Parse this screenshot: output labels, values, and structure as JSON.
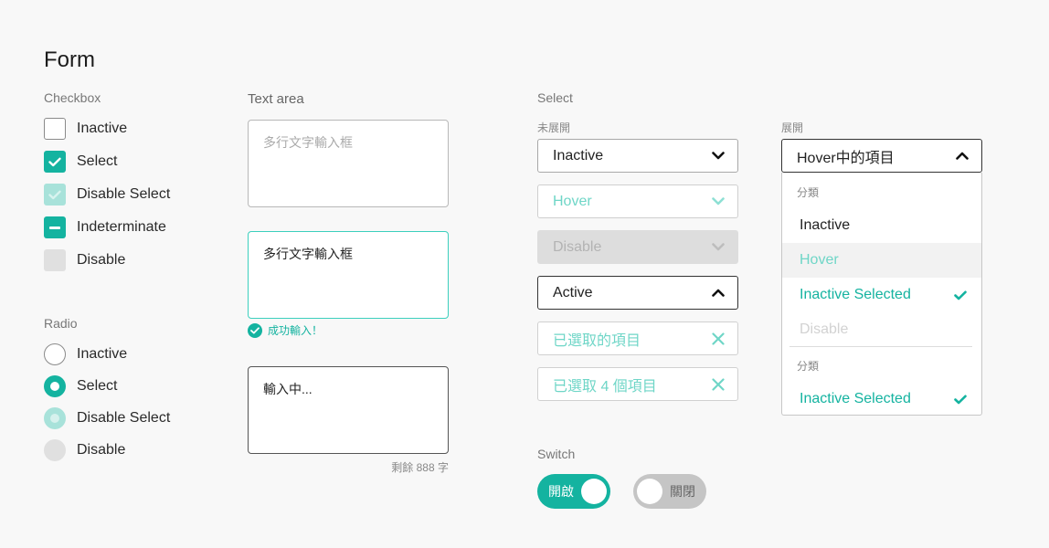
{
  "title": "Form",
  "checkbox": {
    "label": "Checkbox",
    "items": [
      {
        "label": "Inactive"
      },
      {
        "label": "Select"
      },
      {
        "label": "Disable Select"
      },
      {
        "label": "Indeterminate"
      },
      {
        "label": "Disable"
      }
    ]
  },
  "radio": {
    "label": "Radio",
    "items": [
      {
        "label": "Inactive"
      },
      {
        "label": "Select"
      },
      {
        "label": "Disable Select"
      },
      {
        "label": "Disable"
      }
    ]
  },
  "textarea": {
    "label": "Text area",
    "placeholder": "多行文字輸入框",
    "success_value": "多行文字輸入框",
    "success_message": "成功輸入！",
    "typing_value": "輸入中...",
    "counter": "剩餘 888 字"
  },
  "select": {
    "label": "Select",
    "collapsed_label": "未展開",
    "expanded_label": "展開",
    "states": [
      {
        "label": "Inactive"
      },
      {
        "label": "Hover"
      },
      {
        "label": "Disable"
      },
      {
        "label": "Active"
      },
      {
        "label": "已選取的項目"
      },
      {
        "label": "已選取 4 個項目"
      }
    ],
    "dropdown": {
      "head": "Hover中的項目",
      "group1": "分類",
      "group2": "分類",
      "items": [
        {
          "label": "Inactive"
        },
        {
          "label": "Hover"
        },
        {
          "label": "Inactive Selected"
        },
        {
          "label": "Disable"
        },
        {
          "label": "Inactive Selected"
        }
      ]
    }
  },
  "switch": {
    "label": "Switch",
    "on_label": "開啟",
    "off_label": "關閉"
  },
  "colors": {
    "accent": "#14b3a0",
    "accent_light": "#6fd6c7",
    "disabled": "#e0e0e0"
  }
}
